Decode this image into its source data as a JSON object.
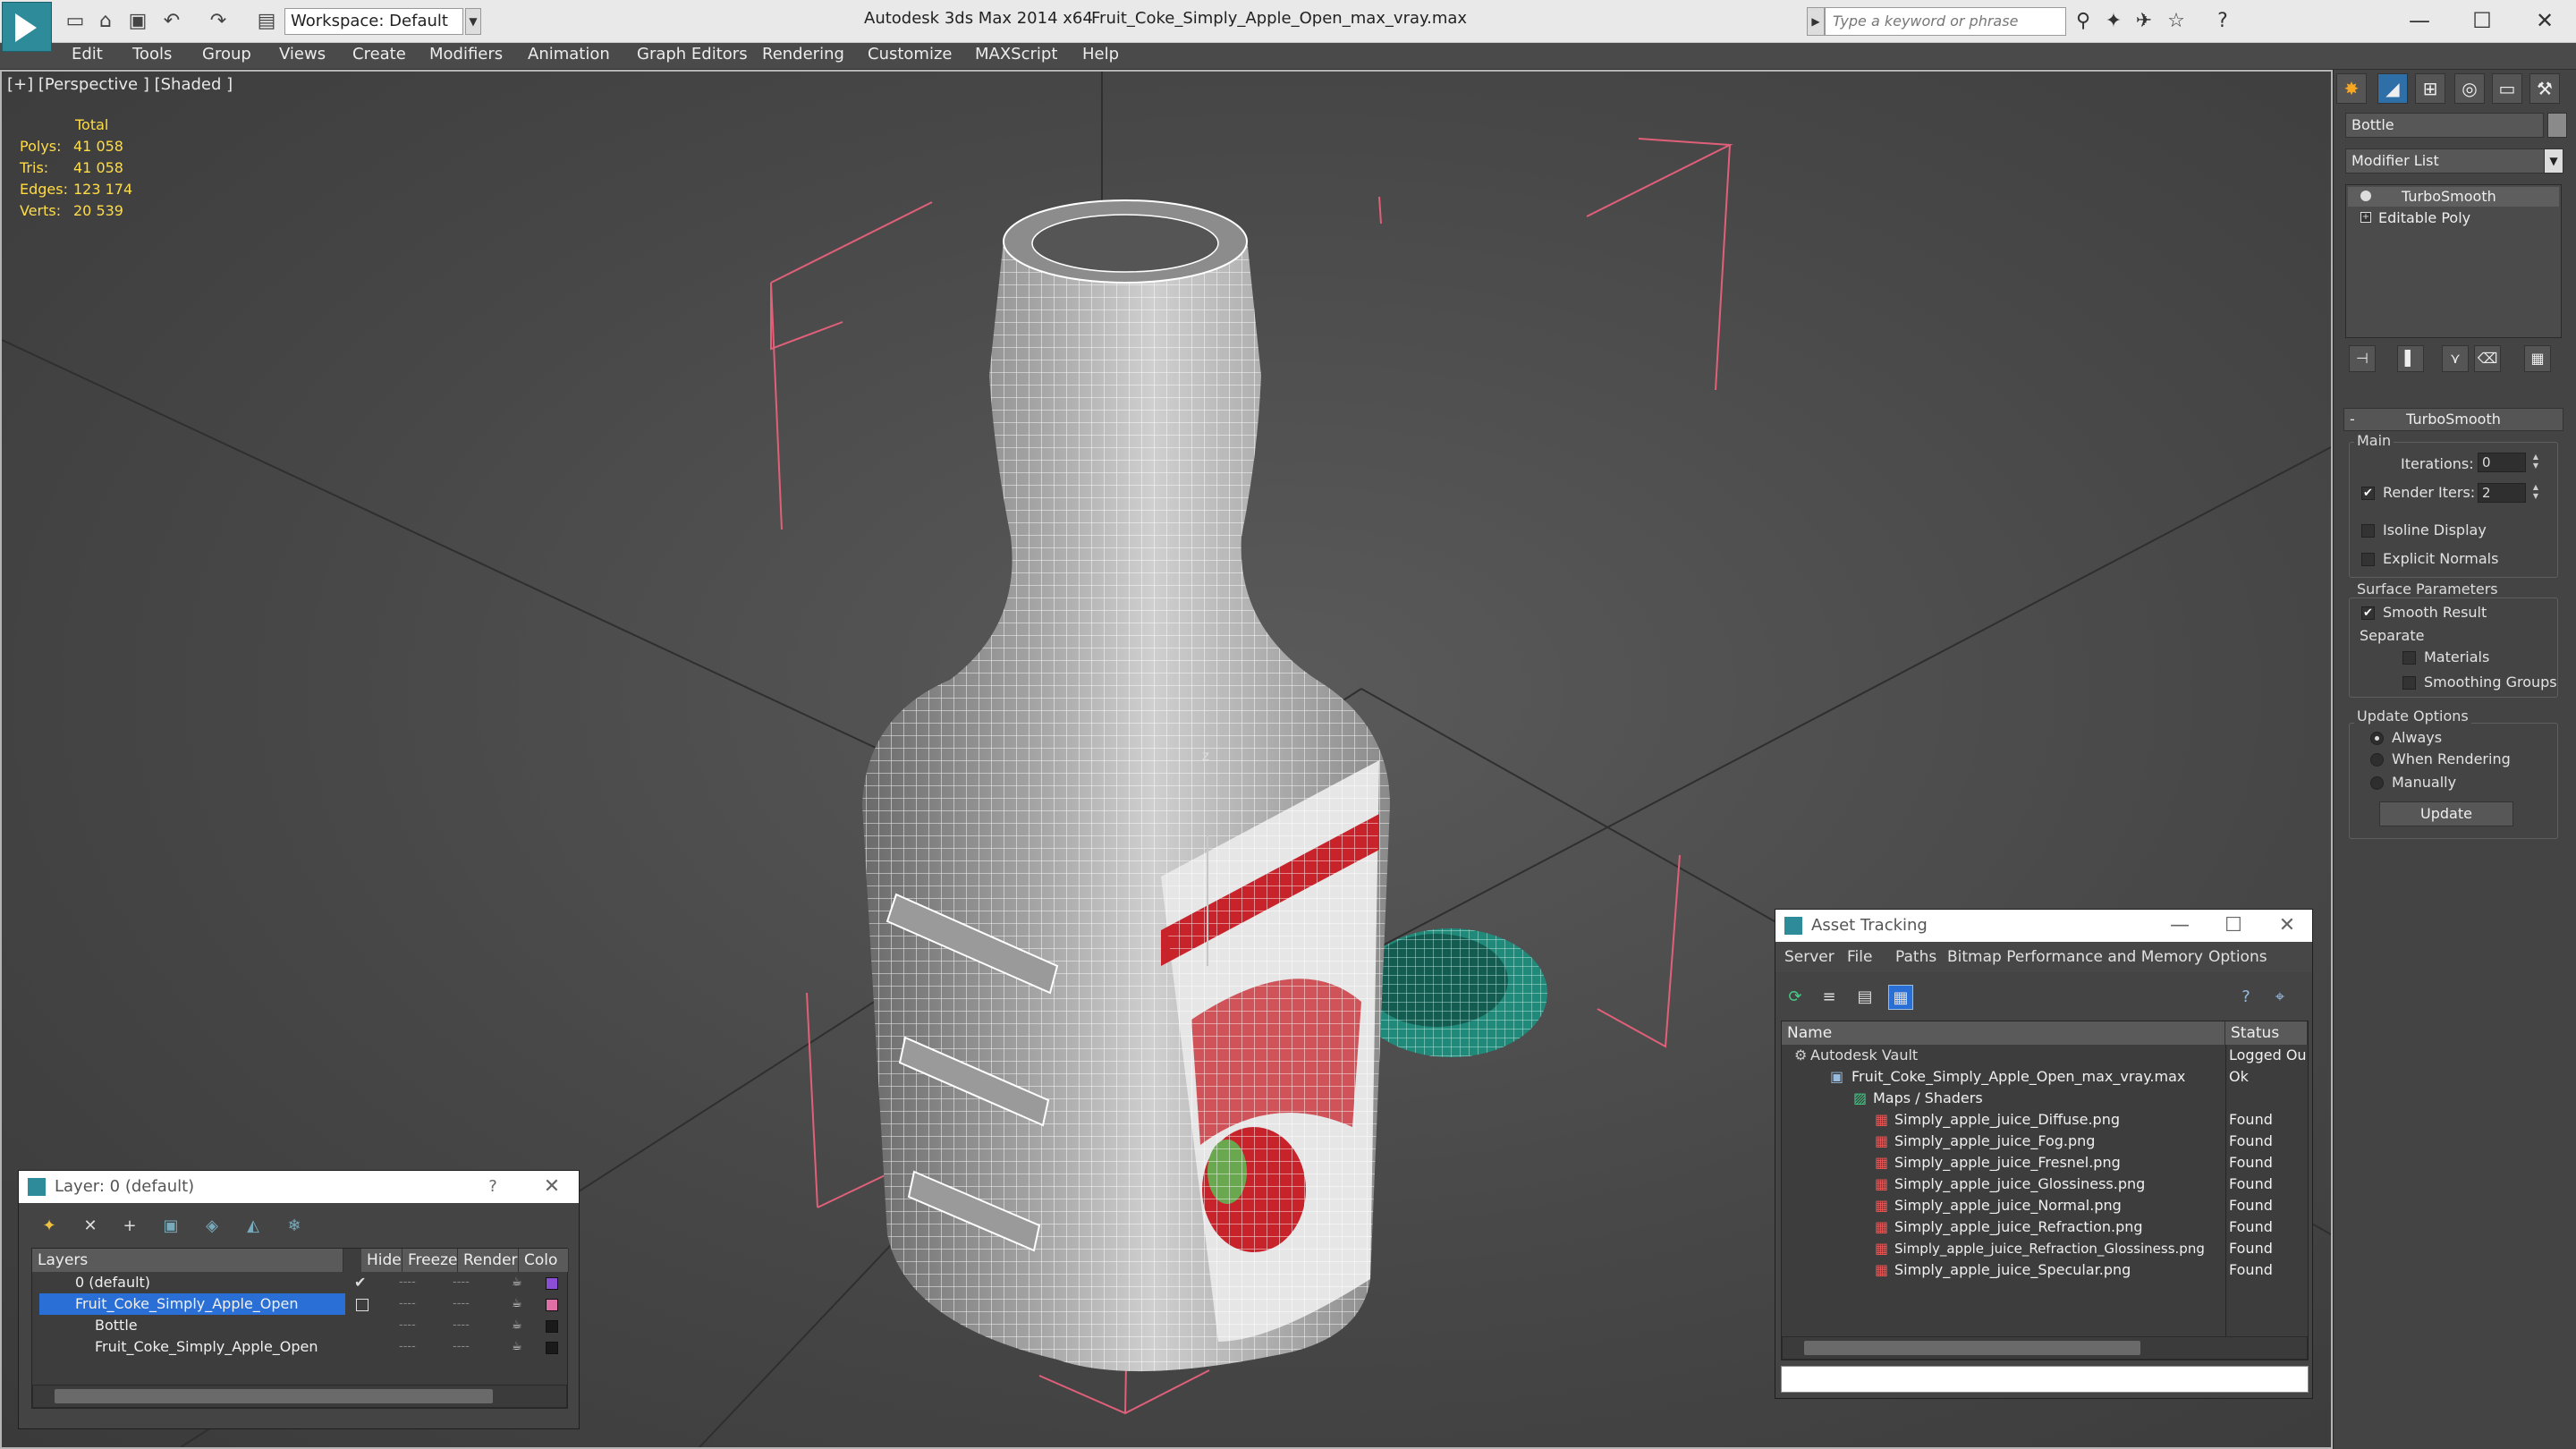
{
  "titlebar": {
    "workspace_label": "Workspace: Default",
    "app_title": "Autodesk 3ds Max  2014 x64",
    "file_title": "Fruit_Coke_Simply_Apple_Open_max_vray.max",
    "search_placeholder": "Type a keyword or phrase"
  },
  "menu": [
    "Edit",
    "Tools",
    "Group",
    "Views",
    "Create",
    "Modifiers",
    "Animation",
    "Graph Editors",
    "Rendering",
    "Customize",
    "MAXScript",
    "Help"
  ],
  "viewport": {
    "label": "[+] [Perspective ] [Shaded ]",
    "stats": {
      "header": "Total",
      "rows": [
        {
          "label": "Polys:",
          "value": "41 058"
        },
        {
          "label": "Tris:",
          "value": "41 058"
        },
        {
          "label": "Edges:",
          "value": "123 174"
        },
        {
          "label": "Verts:",
          "value": "20 539"
        }
      ]
    },
    "axis_label": "z"
  },
  "command_panel": {
    "object_name": "Bottle",
    "modifier_list": "Modifier List",
    "stack": [
      "TurboSmooth",
      "Editable Poly"
    ],
    "turbosmooth": {
      "title": "TurboSmooth",
      "main_group": "Main",
      "iterations_label": "Iterations:",
      "iterations_value": "0",
      "render_iters_label": "Render Iters:",
      "render_iters_value": "2",
      "isoline_label": "Isoline Display",
      "explicit_normals_label": "Explicit Normals",
      "surface_group": "Surface Parameters",
      "smooth_result_label": "Smooth Result",
      "separate_label": "Separate",
      "materials_label": "Materials",
      "smoothing_groups_label": "Smoothing Groups",
      "update_group": "Update Options",
      "always_label": "Always",
      "when_rendering_label": "When Rendering",
      "manually_label": "Manually",
      "update_button": "Update"
    }
  },
  "layer_dialog": {
    "title": "Layer: 0 (default)",
    "help": "?",
    "columns": [
      "Layers",
      "Hide",
      "Freeze",
      "Render",
      "Colo"
    ],
    "rows": [
      {
        "name": "0 (default)",
        "color": "#8a4fd6"
      },
      {
        "name": "Fruit_Coke_Simply_Apple_Open",
        "color": "#e06fa6"
      },
      {
        "name": "Bottle",
        "color": "#1a1a1a"
      },
      {
        "name": "Fruit_Coke_Simply_Apple_Open",
        "color": "#1a1a1a"
      }
    ]
  },
  "asset_dialog": {
    "title": "Asset Tracking",
    "menu": [
      "Server",
      "File",
      "Paths",
      "Bitmap Performance and Memory",
      "Options"
    ],
    "columns": [
      "Name",
      "Status"
    ],
    "rows": [
      {
        "name": "Autodesk Vault",
        "status": "Logged Ou"
      },
      {
        "name": "Fruit_Coke_Simply_Apple_Open_max_vray.max",
        "status": "Ok"
      },
      {
        "name": "Maps / Shaders",
        "status": ""
      },
      {
        "name": "Simply_apple_juice_Diffuse.png",
        "status": "Found"
      },
      {
        "name": "Simply_apple_juice_Fog.png",
        "status": "Found"
      },
      {
        "name": "Simply_apple_juice_Fresnel.png",
        "status": "Found"
      },
      {
        "name": "Simply_apple_juice_Glossiness.png",
        "status": "Found"
      },
      {
        "name": "Simply_apple_juice_Normal.png",
        "status": "Found"
      },
      {
        "name": "Simply_apple_juice_Refraction.png",
        "status": "Found"
      },
      {
        "name": "Simply_apple_juice_Refraction_Glossiness.png",
        "status": "Found"
      },
      {
        "name": "Simply_apple_juice_Specular.png",
        "status": "Found"
      }
    ]
  },
  "colors": {
    "selection": "#2a6fd6",
    "stats_yellow": "#ffdc46",
    "bbox_pink": "#e0607a",
    "cap_teal": "#1f8a7a",
    "label_red": "#c8222a"
  }
}
